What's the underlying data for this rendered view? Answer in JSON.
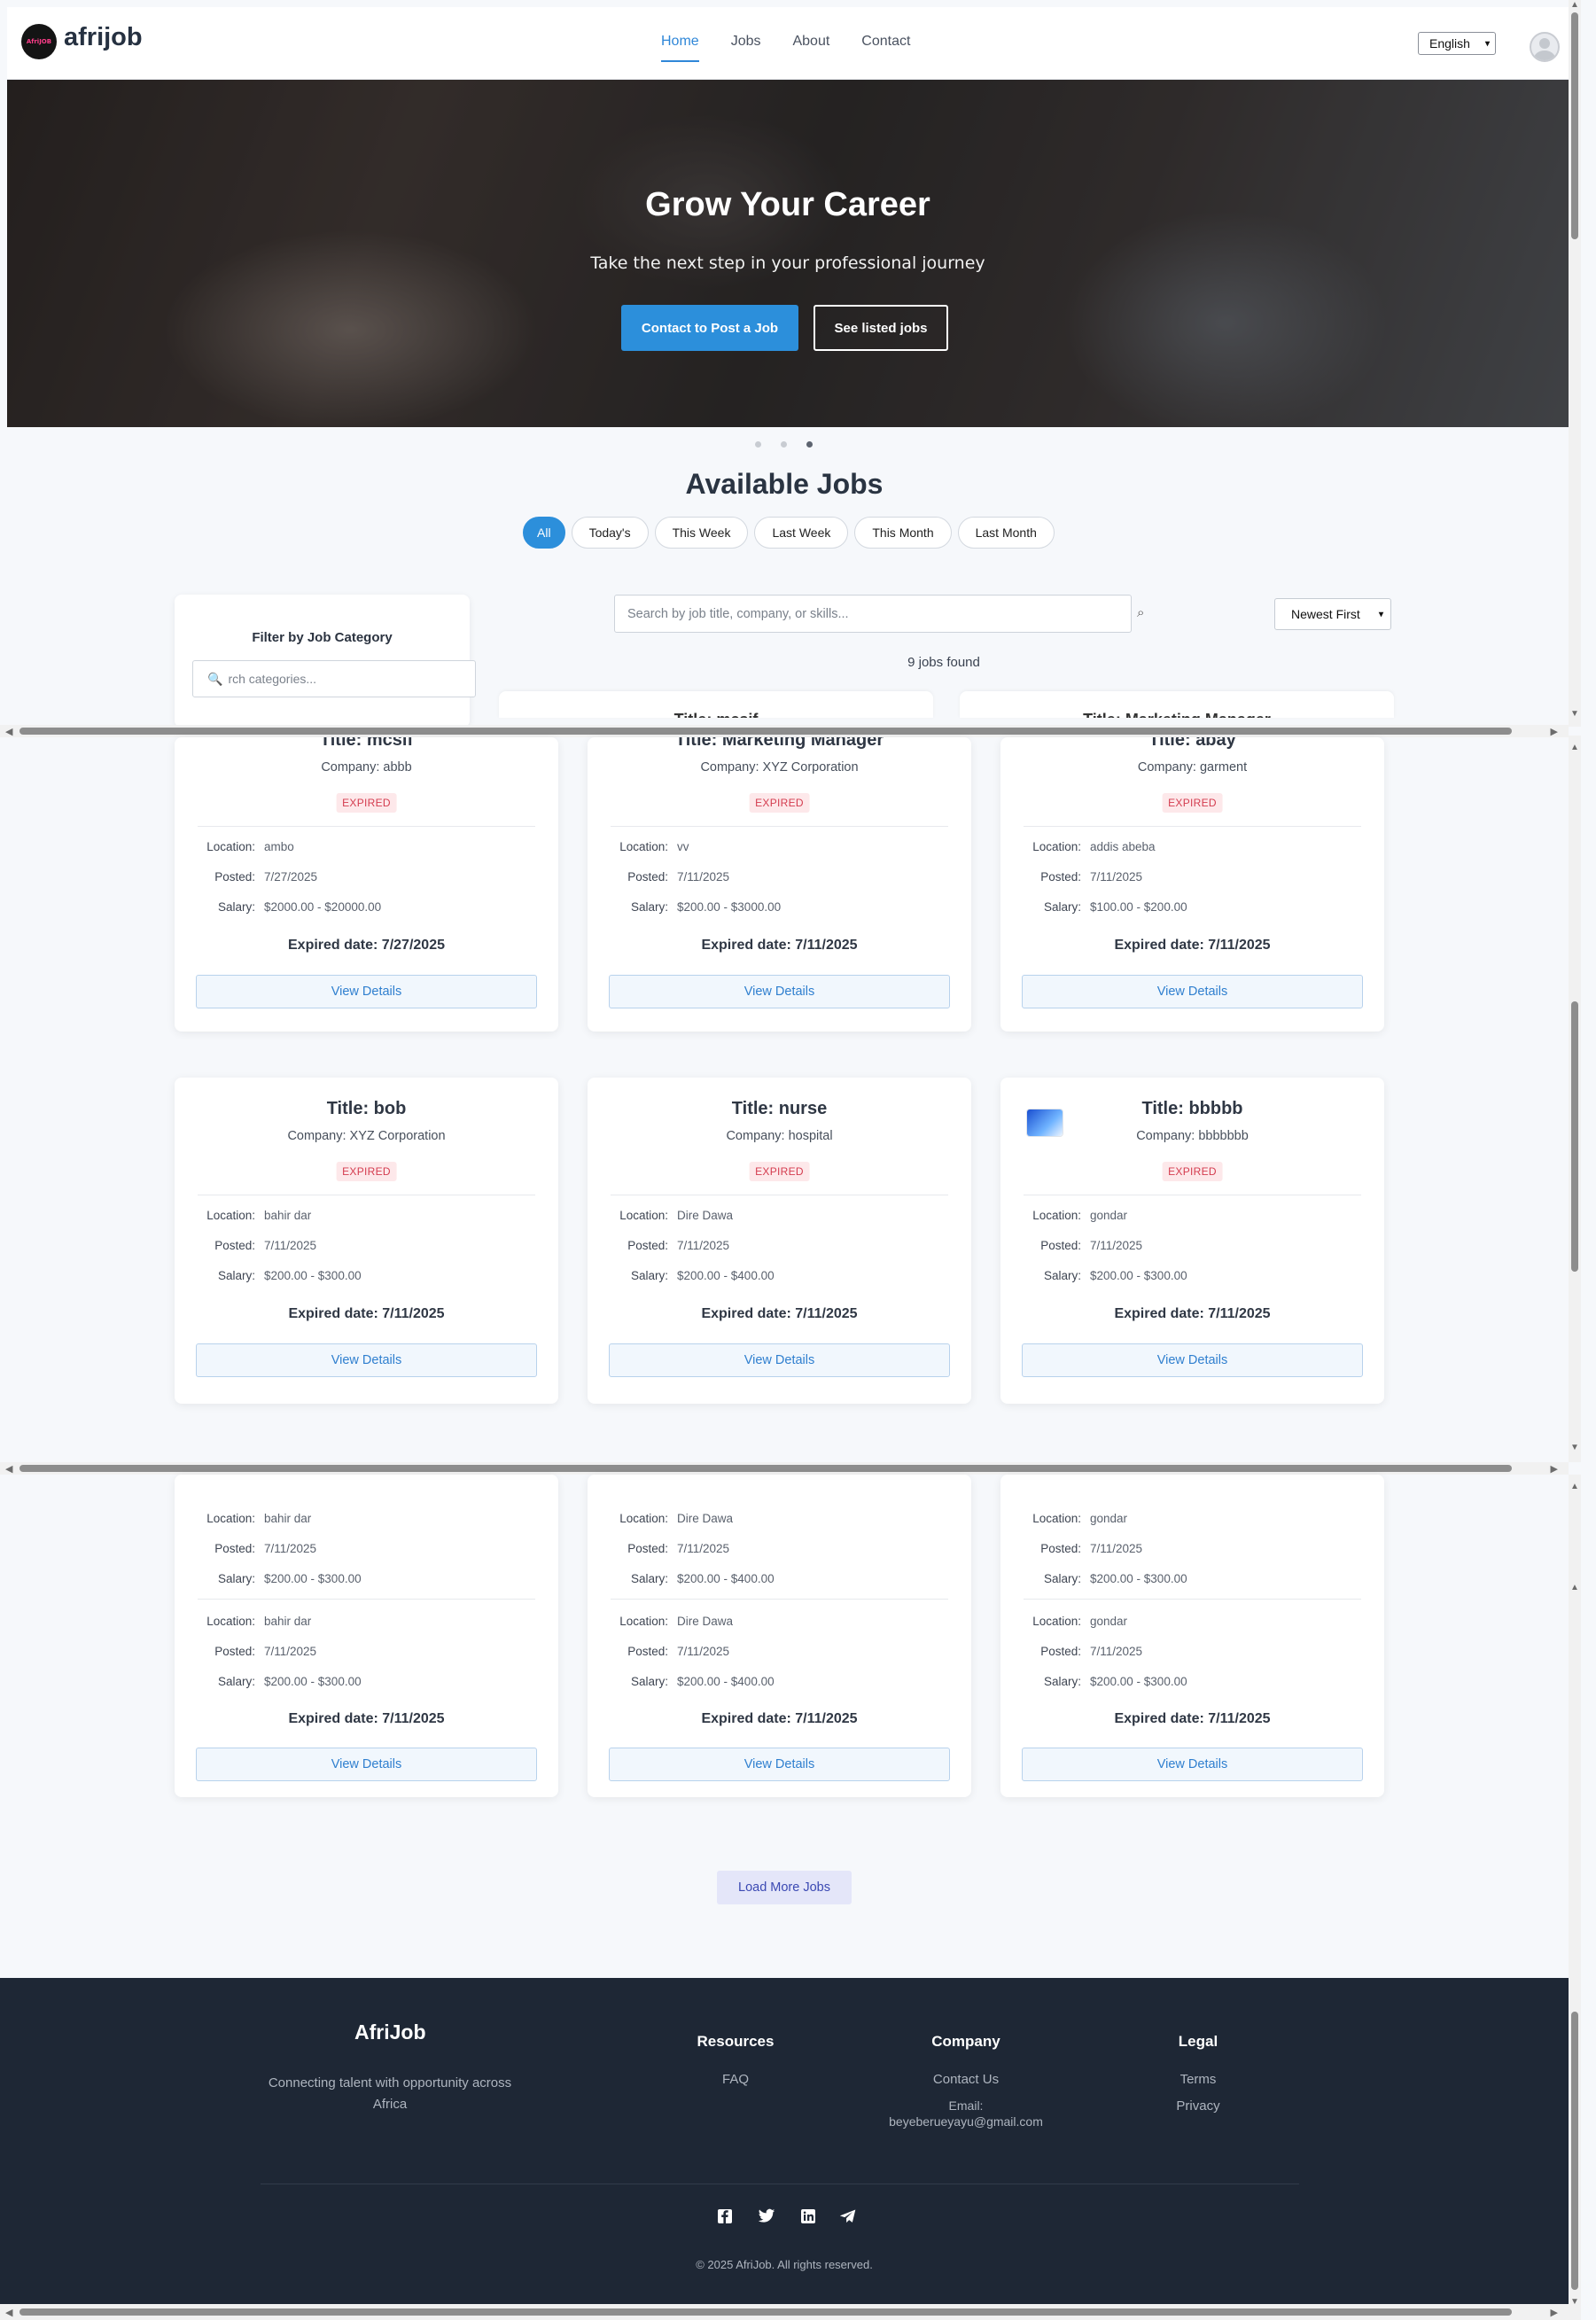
{
  "header": {
    "logo_text": "AfriJOB",
    "brand": "afrijob",
    "nav": [
      "Home",
      "Jobs",
      "About",
      "Contact"
    ],
    "language": "English"
  },
  "hero": {
    "title": "Grow Your Career",
    "subtitle": "Take the next step in your professional journey",
    "primary_button": "Contact to Post a Job",
    "secondary_button": "See listed jobs",
    "slide_count": 3,
    "active_slide": 3
  },
  "jobs": {
    "heading": "Available Jobs",
    "filters": [
      "All",
      "Today's",
      "This Week",
      "Last Week",
      "This Month",
      "Last Month"
    ],
    "active_filter": "All",
    "search_placeholder": "Search by job title, company, or skills...",
    "sort": "Newest First",
    "count_text": "9 jobs found",
    "peek_titles": [
      "Title: mcsif",
      "Title: Marketing Manager"
    ],
    "load_more": "Load More Jobs"
  },
  "filter_panel": {
    "title": "Filter by Job Category",
    "search_value": "rch categories..."
  },
  "labels": {
    "location": "Location:",
    "posted": "Posted:",
    "salary": "Salary:",
    "view_details": "View Details"
  },
  "cards_row1": [
    {
      "title": "Title: mcsif",
      "company": "Company: abbb",
      "badge": "EXPIRED",
      "location": "ambo",
      "posted": "7/27/2025",
      "salary": "$2000.00 - $20000.00",
      "expired": "Expired date: 7/27/2025"
    },
    {
      "title": "Title: Marketing Manager",
      "company": "Company: XYZ Corporation",
      "badge": "EXPIRED",
      "location": "vv",
      "posted": "7/11/2025",
      "salary": "$200.00 - $3000.00",
      "expired": "Expired date: 7/11/2025"
    },
    {
      "title": "Title: abay",
      "company": "Company: garment",
      "badge": "EXPIRED",
      "location": "addis abeba",
      "posted": "7/11/2025",
      "salary": "$100.00 - $200.00",
      "expired": "Expired date: 7/11/2025"
    }
  ],
  "cards_row2": [
    {
      "title": "Title: bob",
      "company": "Company: XYZ Corporation",
      "badge": "EXPIRED",
      "location": "bahir dar",
      "posted": "7/11/2025",
      "salary": "$200.00 - $300.00",
      "expired": "Expired date: 7/11/2025"
    },
    {
      "title": "Title: nurse",
      "company": "Company: hospital",
      "badge": "EXPIRED",
      "location": "Dire Dawa",
      "posted": "7/11/2025",
      "salary": "$200.00 - $400.00",
      "expired": "Expired date: 7/11/2025"
    },
    {
      "title": "Title: bbbbb",
      "company": "Company: bbbbbbb",
      "badge": "EXPIRED",
      "location": "gondar",
      "posted": "7/11/2025",
      "salary": "$200.00 - $300.00",
      "expired": "Expired date: 7/11/2025"
    }
  ],
  "cards_row3": [
    {
      "location": "bahir dar",
      "posted": "7/11/2025",
      "salary": "$200.00 - $300.00",
      "location2": "bahir dar",
      "posted2": "7/11/2025",
      "salary2": "$200.00 - $300.00",
      "expired": "Expired date: 7/11/2025"
    },
    {
      "location": "Dire Dawa",
      "posted": "7/11/2025",
      "salary": "$200.00 - $400.00",
      "location2": "Dire Dawa",
      "posted2": "7/11/2025",
      "salary2": "$200.00 - $400.00",
      "expired": "Expired date: 7/11/2025"
    },
    {
      "location": "gondar",
      "posted": "7/11/2025",
      "salary": "$200.00 - $300.00",
      "location2": "gondar",
      "posted2": "7/11/2025",
      "salary2": "$200.00 - $300.00",
      "expired": "Expired date: 7/11/2025"
    }
  ],
  "footer": {
    "brand": "AfriJob",
    "tagline": "Connecting talent with opportunity across Africa",
    "resources_heading": "Resources",
    "resources": [
      "FAQ"
    ],
    "company_heading": "Company",
    "company_links": [
      "Contact Us"
    ],
    "email_label": "Email:",
    "email": "beyeberueyayu@gmail.com",
    "legal_heading": "Legal",
    "legal": [
      "Terms",
      "Privacy"
    ],
    "social": [
      "facebook-icon",
      "twitter-icon",
      "linkedin-icon",
      "telegram-icon"
    ],
    "copyright": "© 2025 AfriJob. All rights reserved."
  }
}
